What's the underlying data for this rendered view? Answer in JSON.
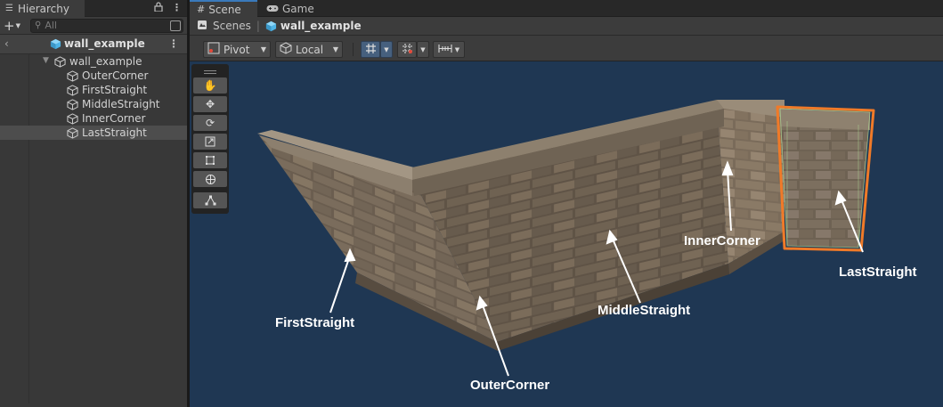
{
  "hierarchy": {
    "tab_title": "Hierarchy",
    "search": {
      "placeholder": "All"
    },
    "scene_name": "wall_example",
    "root": {
      "label": "wall_example"
    },
    "children": [
      {
        "label": "OuterCorner"
      },
      {
        "label": "FirstStraight"
      },
      {
        "label": "MiddleStraight"
      },
      {
        "label": "InnerCorner"
      },
      {
        "label": "LastStraight",
        "selected": true
      }
    ]
  },
  "scene_view": {
    "tabs": [
      {
        "label": "Scene",
        "active": true
      },
      {
        "label": "Game",
        "active": false
      }
    ],
    "breadcrumb": {
      "root": "Scenes",
      "current": "wall_example"
    },
    "toolbar": {
      "pivot_label": "Pivot",
      "space_label": "Local"
    },
    "tools": [
      "hand-tool",
      "move-tool",
      "rotate-tool",
      "scale-tool",
      "rect-tool",
      "transform-tool",
      "custom-editor-tool"
    ],
    "annotations": {
      "first_straight": "FirstStraight",
      "outer_corner": "OuterCorner",
      "middle_straight": "MiddleStraight",
      "inner_corner": "InnerCorner",
      "last_straight": "LastStraight"
    }
  },
  "colors": {
    "viewport_bg": "#1f3753",
    "selection_outline": "#f07a28",
    "accent_tab": "#3a79bb",
    "cube_icon": "#5ac0f0"
  }
}
